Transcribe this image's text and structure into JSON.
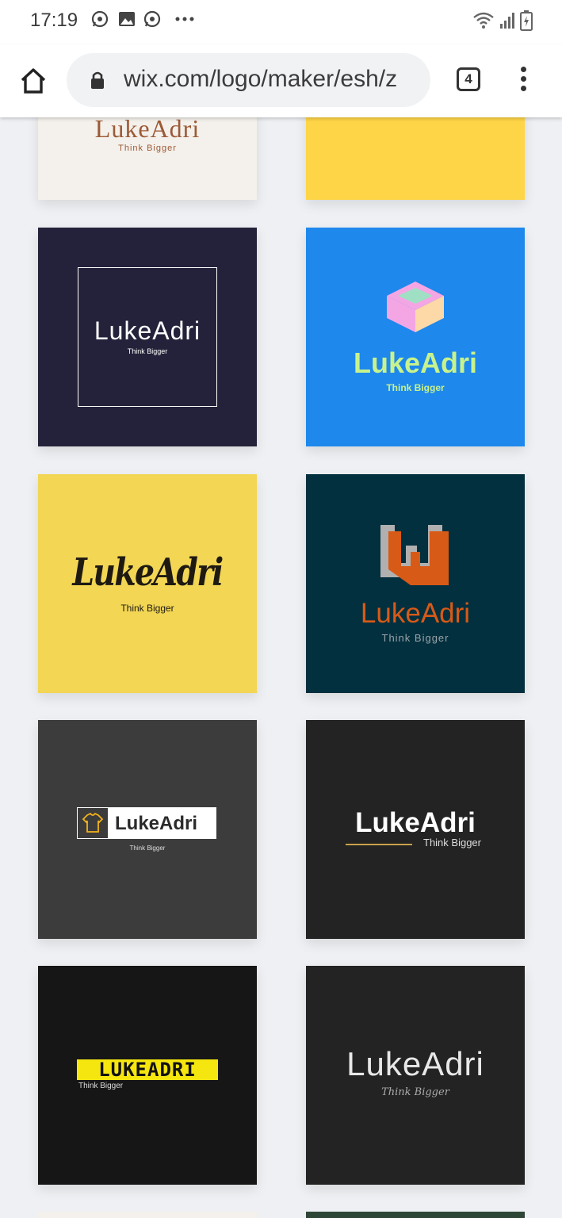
{
  "status_bar": {
    "time": "17:19",
    "notification_icons": [
      "whatsapp-icon",
      "gallery-icon",
      "whatsapp-icon",
      "more-dots-icon"
    ],
    "system_icons": [
      "wifi-icon",
      "signal-icon",
      "battery-charging-icon"
    ]
  },
  "browser": {
    "url": "wix.com/logo/maker/esh/z",
    "tab_count": "4"
  },
  "logos": [
    {
      "name": "LukeAdri",
      "tagline": "Think Bigger"
    },
    {
      "name": "",
      "tagline": ""
    },
    {
      "name": "LukeAdri",
      "tagline": "Think Bigger"
    },
    {
      "name": "LukeAdri",
      "tagline": "Think Bigger"
    },
    {
      "name": "LukeAdri",
      "tagline": "Think Bigger"
    },
    {
      "name": "LukeAdri",
      "tagline": "Think Bigger"
    },
    {
      "name": "LukeAdri",
      "tagline": "Think Bigger"
    },
    {
      "name": "LukeAdri",
      "tagline": "Think Bigger"
    },
    {
      "name": "LUKEADRI",
      "tagline": "Think Bigger"
    },
    {
      "name": "LukeAdri",
      "tagline": "Think Bigger"
    }
  ],
  "colors": {
    "page_bg": "#eef0f3",
    "tile_cream": "#f4f0eb",
    "tile_yellow_top": "#fed546",
    "tile_navy": "#23223a",
    "tile_blue": "#1e88ec",
    "tile_yellow": "#f2d654",
    "tile_teal": "#03303f",
    "tile_gray": "#3c3c3c",
    "tile_charcoal": "#232323",
    "tile_black": "#161616",
    "accent_orange": "#d85a17",
    "accent_lime": "#c8f28c",
    "accent_yellow": "#f5e60f"
  }
}
